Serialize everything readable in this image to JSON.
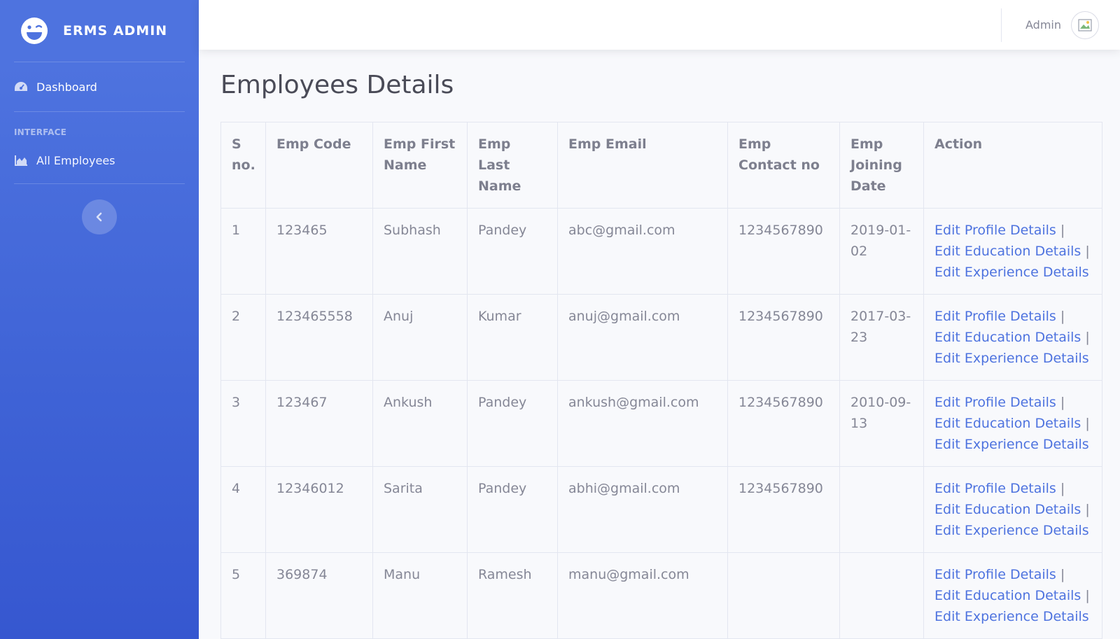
{
  "brand": {
    "name": "ERMS ADMIN"
  },
  "sidebar": {
    "dashboard_label": "Dashboard",
    "section_heading": "INTERFACE",
    "employees_label": "All Employees"
  },
  "topbar": {
    "user_name": "Admin"
  },
  "page": {
    "title": "Employees Details"
  },
  "table": {
    "headers": [
      "S no.",
      "Emp Code",
      "Emp First Name",
      "Emp Last Name",
      "Emp Email",
      "Emp Contact no",
      "Emp Joining Date",
      "Action"
    ],
    "actions": {
      "profile": "Edit Profile Details",
      "education": "Edit Education Details",
      "experience": "Edit Experience Details",
      "separator": "|"
    },
    "rows": [
      {
        "sno": "1",
        "code": "123465",
        "first": "Subhash",
        "last": "Pandey",
        "email": "abc@gmail.com",
        "contact": "1234567890",
        "joining": "2019-01-02"
      },
      {
        "sno": "2",
        "code": "123465558",
        "first": "Anuj",
        "last": "Kumar",
        "email": "anuj@gmail.com",
        "contact": "1234567890",
        "joining": "2017-03-23"
      },
      {
        "sno": "3",
        "code": "123467",
        "first": "Ankush",
        "last": "Pandey",
        "email": "ankush@gmail.com",
        "contact": "1234567890",
        "joining": "2010-09-13"
      },
      {
        "sno": "4",
        "code": "12346012",
        "first": "Sarita",
        "last": "Pandey",
        "email": "abhi@gmail.com",
        "contact": "1234567890",
        "joining": ""
      },
      {
        "sno": "5",
        "code": "369874",
        "first": "Manu",
        "last": "Ramesh",
        "email": "manu@gmail.com",
        "contact": "",
        "joining": ""
      }
    ]
  },
  "colors": {
    "sidebar": "#4e73df",
    "link": "#4e73df",
    "text": "#858796"
  }
}
